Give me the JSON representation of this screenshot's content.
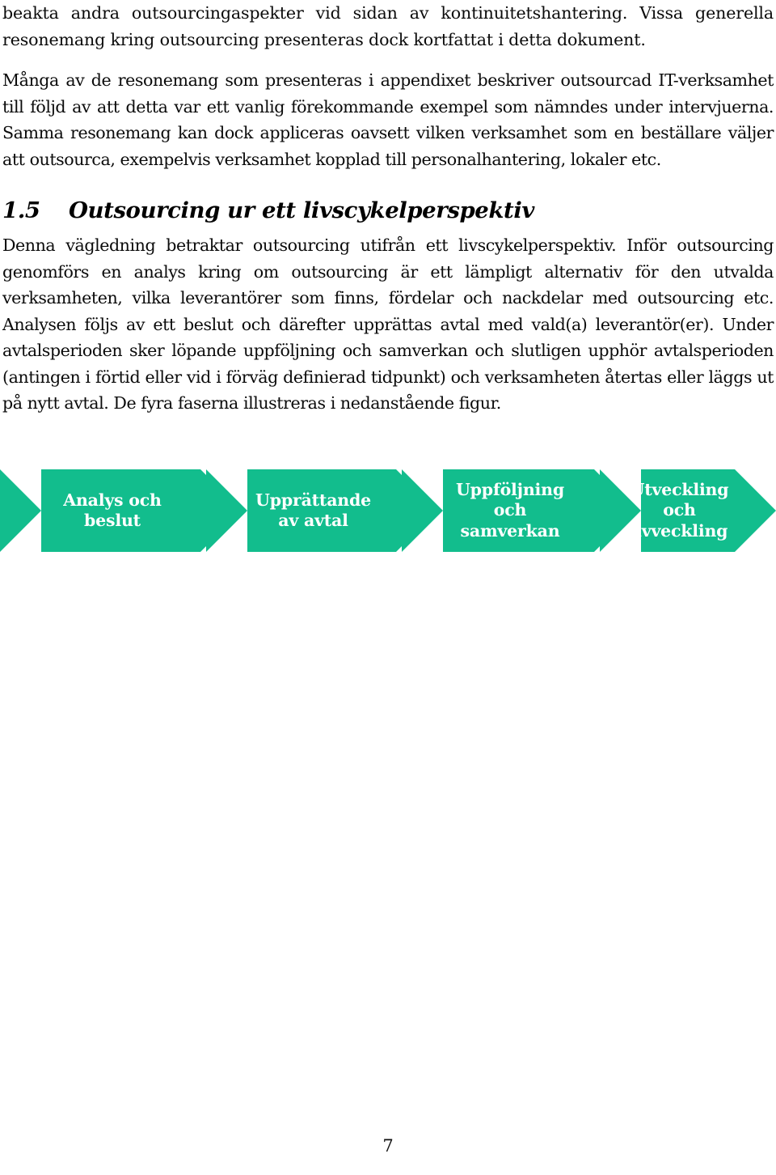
{
  "document": {
    "language": "sv",
    "page_number": "7",
    "accent_color": "#12BD8D",
    "text_color": "#0b0b0b"
  },
  "paragraphs": [
    {
      "id": "intro",
      "text": "beakta andra outsourcingaspekter vid sidan av kontinuitetshantering. Vissa generella resonemang kring outsourcing presenteras dock kortfattat i detta dokument."
    },
    {
      "id": "appendix",
      "text": "Många av de resonemang som presenteras i appendixet beskriver outsourcad IT-verksamhet till följd av att detta var ett vanlig förekommande exempel som nämndes under intervjuerna. Samma resonemang kan dock appliceras oavsett vilken verksamhet som en beställare väljer att outsourca, exempelvis verksamhet kopplad till personalhantering, lokaler etc."
    },
    {
      "id": "lifecycle",
      "text": "Denna vägledning betraktar outsourcing utifrån ett livscykelperspektiv. Inför outsourcing genomförs en analys kring om outsourcing är ett lämpligt alternativ för den utvalda verksamheten, vilka leverantörer som finns, fördelar och nackdelar med outsourcing etc. Analysen följs av ett beslut och därefter upprättas avtal med vald(a) leverantör(er). Under avtalsperioden sker löpande uppföljning och samverkan och slutligen upphör avtalsperioden (antingen i förtid eller vid i förväg definierad tidpunkt) och verksamheten återtas eller läggs ut på nytt avtal. De fyra faserna illustreras i nedanstående figur."
    }
  ],
  "heading": {
    "number": "1.5",
    "title": "Outsourcing ur ett livscykelperspektiv"
  },
  "figure": {
    "name": "outsourcing-lifecycle-phases",
    "phases": [
      {
        "label": "Analys och\nbeslut"
      },
      {
        "label": "Upprättande\nav avtal"
      },
      {
        "label": "Uppföljning\noch\nsamverkan"
      },
      {
        "label": "Utveckling\noch\navveckling"
      }
    ]
  },
  "footer": {
    "page_number": "7"
  }
}
